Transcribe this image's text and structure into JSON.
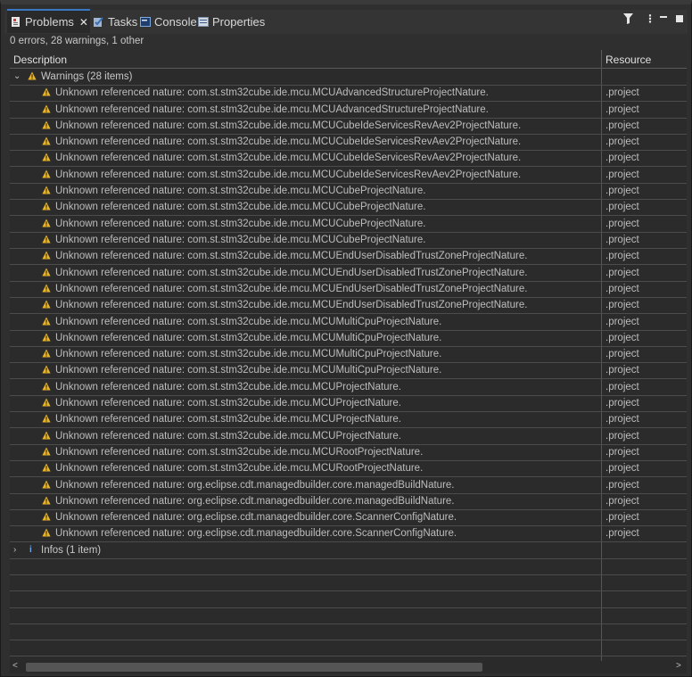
{
  "tabs": [
    {
      "label": "Problems",
      "icon": "problems-icon"
    },
    {
      "label": "Tasks",
      "icon": "tasks-icon"
    },
    {
      "label": "Console",
      "icon": "console-icon"
    },
    {
      "label": "Properties",
      "icon": "properties-icon"
    }
  ],
  "summary": "0 errors, 28 warnings, 1 other",
  "columns": {
    "description": "Description",
    "resource": "Resource"
  },
  "groups": {
    "warnings": "Warnings (28 items)",
    "infos": "Infos (1 item)"
  },
  "warnings": [
    {
      "desc": "Unknown referenced nature: com.st.stm32cube.ide.mcu.MCUAdvancedStructureProjectNature.",
      "res": ".project"
    },
    {
      "desc": "Unknown referenced nature: com.st.stm32cube.ide.mcu.MCUAdvancedStructureProjectNature.",
      "res": ".project"
    },
    {
      "desc": "Unknown referenced nature: com.st.stm32cube.ide.mcu.MCUCubeIdeServicesRevAev2ProjectNature.",
      "res": ".project"
    },
    {
      "desc": "Unknown referenced nature: com.st.stm32cube.ide.mcu.MCUCubeIdeServicesRevAev2ProjectNature.",
      "res": ".project"
    },
    {
      "desc": "Unknown referenced nature: com.st.stm32cube.ide.mcu.MCUCubeIdeServicesRevAev2ProjectNature.",
      "res": ".project"
    },
    {
      "desc": "Unknown referenced nature: com.st.stm32cube.ide.mcu.MCUCubeIdeServicesRevAev2ProjectNature.",
      "res": ".project"
    },
    {
      "desc": "Unknown referenced nature: com.st.stm32cube.ide.mcu.MCUCubeProjectNature.",
      "res": ".project"
    },
    {
      "desc": "Unknown referenced nature: com.st.stm32cube.ide.mcu.MCUCubeProjectNature.",
      "res": ".project"
    },
    {
      "desc": "Unknown referenced nature: com.st.stm32cube.ide.mcu.MCUCubeProjectNature.",
      "res": ".project"
    },
    {
      "desc": "Unknown referenced nature: com.st.stm32cube.ide.mcu.MCUCubeProjectNature.",
      "res": ".project"
    },
    {
      "desc": "Unknown referenced nature: com.st.stm32cube.ide.mcu.MCUEndUserDisabledTrustZoneProjectNature.",
      "res": ".project"
    },
    {
      "desc": "Unknown referenced nature: com.st.stm32cube.ide.mcu.MCUEndUserDisabledTrustZoneProjectNature.",
      "res": ".project"
    },
    {
      "desc": "Unknown referenced nature: com.st.stm32cube.ide.mcu.MCUEndUserDisabledTrustZoneProjectNature.",
      "res": ".project"
    },
    {
      "desc": "Unknown referenced nature: com.st.stm32cube.ide.mcu.MCUEndUserDisabledTrustZoneProjectNature.",
      "res": ".project"
    },
    {
      "desc": "Unknown referenced nature: com.st.stm32cube.ide.mcu.MCUMultiCpuProjectNature.",
      "res": ".project"
    },
    {
      "desc": "Unknown referenced nature: com.st.stm32cube.ide.mcu.MCUMultiCpuProjectNature.",
      "res": ".project"
    },
    {
      "desc": "Unknown referenced nature: com.st.stm32cube.ide.mcu.MCUMultiCpuProjectNature.",
      "res": ".project"
    },
    {
      "desc": "Unknown referenced nature: com.st.stm32cube.ide.mcu.MCUMultiCpuProjectNature.",
      "res": ".project"
    },
    {
      "desc": "Unknown referenced nature: com.st.stm32cube.ide.mcu.MCUProjectNature.",
      "res": ".project"
    },
    {
      "desc": "Unknown referenced nature: com.st.stm32cube.ide.mcu.MCUProjectNature.",
      "res": ".project"
    },
    {
      "desc": "Unknown referenced nature: com.st.stm32cube.ide.mcu.MCUProjectNature.",
      "res": ".project"
    },
    {
      "desc": "Unknown referenced nature: com.st.stm32cube.ide.mcu.MCUProjectNature.",
      "res": ".project"
    },
    {
      "desc": "Unknown referenced nature: com.st.stm32cube.ide.mcu.MCURootProjectNature.",
      "res": ".project"
    },
    {
      "desc": "Unknown referenced nature: com.st.stm32cube.ide.mcu.MCURootProjectNature.",
      "res": ".project"
    },
    {
      "desc": "Unknown referenced nature: org.eclipse.cdt.managedbuilder.core.managedBuildNature.",
      "res": ".project"
    },
    {
      "desc": "Unknown referenced nature: org.eclipse.cdt.managedbuilder.core.managedBuildNature.",
      "res": ".project"
    },
    {
      "desc": "Unknown referenced nature: org.eclipse.cdt.managedbuilder.core.ScannerConfigNature.",
      "res": ".project"
    },
    {
      "desc": "Unknown referenced nature: org.eclipse.cdt.managedbuilder.core.ScannerConfigNature.",
      "res": ".project"
    }
  ],
  "icons": {
    "close": "close-icon",
    "filter": "filter-icon",
    "menu": "view-menu-icon",
    "minimize": "minimize-icon",
    "maximize": "maximize-icon",
    "warning": "warning-icon",
    "info": "info-icon"
  },
  "colors": {
    "accent": "#3b78c4",
    "warning": "#e8b52a",
    "info": "#6fa6e6"
  }
}
